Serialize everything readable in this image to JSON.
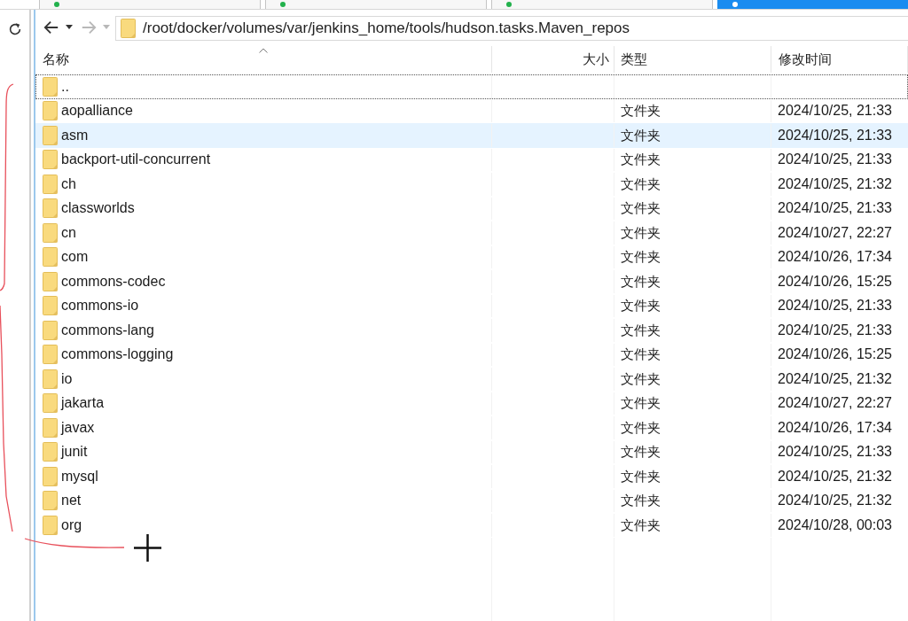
{
  "tabs": [
    {
      "selected": false
    },
    {
      "selected": false
    },
    {
      "selected": false
    },
    {
      "selected": true
    }
  ],
  "navigation": [
    {
      "kind": "back",
      "disabled": false
    },
    {
      "kind": "forward",
      "disabled": true
    }
  ],
  "address_bar": {
    "path": "/root/docker/volumes/var/jenkins_home/tools/hudson.tasks.Maven_repos"
  },
  "table": {
    "columns": [
      {
        "label": "名称",
        "sorted": true
      },
      {
        "label": "大小",
        "sorted": false
      },
      {
        "label": "类型",
        "sorted": false
      },
      {
        "label": "修改时间",
        "sorted": false
      }
    ],
    "rows": [
      {
        "name": "..",
        "focused": true,
        "hovered": false
      },
      {
        "name": "aopalliance",
        "type": "文件夹",
        "modified": "2024/10/25, 21:33",
        "focused": false,
        "hovered": false
      },
      {
        "name": "asm",
        "type": "文件夹",
        "modified": "2024/10/25, 21:33",
        "focused": false,
        "hovered": true
      },
      {
        "name": "backport-util-concurrent",
        "type": "文件夹",
        "modified": "2024/10/25, 21:33",
        "focused": false,
        "hovered": false
      },
      {
        "name": "ch",
        "type": "文件夹",
        "modified": "2024/10/25, 21:32",
        "focused": false,
        "hovered": false
      },
      {
        "name": "classworlds",
        "type": "文件夹",
        "modified": "2024/10/25, 21:33",
        "focused": false,
        "hovered": false
      },
      {
        "name": "cn",
        "type": "文件夹",
        "modified": "2024/10/27, 22:27",
        "focused": false,
        "hovered": false
      },
      {
        "name": "com",
        "type": "文件夹",
        "modified": "2024/10/26, 17:34",
        "focused": false,
        "hovered": false
      },
      {
        "name": "commons-codec",
        "type": "文件夹",
        "modified": "2024/10/26, 15:25",
        "focused": false,
        "hovered": false
      },
      {
        "name": "commons-io",
        "type": "文件夹",
        "modified": "2024/10/25, 21:33",
        "focused": false,
        "hovered": false
      },
      {
        "name": "commons-lang",
        "type": "文件夹",
        "modified": "2024/10/25, 21:33",
        "focused": false,
        "hovered": false
      },
      {
        "name": "commons-logging",
        "type": "文件夹",
        "modified": "2024/10/26, 15:25",
        "focused": false,
        "hovered": false
      },
      {
        "name": "io",
        "type": "文件夹",
        "modified": "2024/10/25, 21:32",
        "focused": false,
        "hovered": false
      },
      {
        "name": "jakarta",
        "type": "文件夹",
        "modified": "2024/10/27, 22:27",
        "focused": false,
        "hovered": false
      },
      {
        "name": "javax",
        "type": "文件夹",
        "modified": "2024/10/26, 17:34",
        "focused": false,
        "hovered": false
      },
      {
        "name": "junit",
        "type": "文件夹",
        "modified": "2024/10/25, 21:33",
        "focused": false,
        "hovered": false
      },
      {
        "name": "mysql",
        "type": "文件夹",
        "modified": "2024/10/25, 21:32",
        "focused": false,
        "hovered": false
      },
      {
        "name": "net",
        "type": "文件夹",
        "modified": "2024/10/25, 21:32",
        "focused": false,
        "hovered": false
      },
      {
        "name": "org",
        "type": "文件夹",
        "modified": "2024/10/28, 00:03",
        "focused": false,
        "hovered": false
      }
    ]
  }
}
